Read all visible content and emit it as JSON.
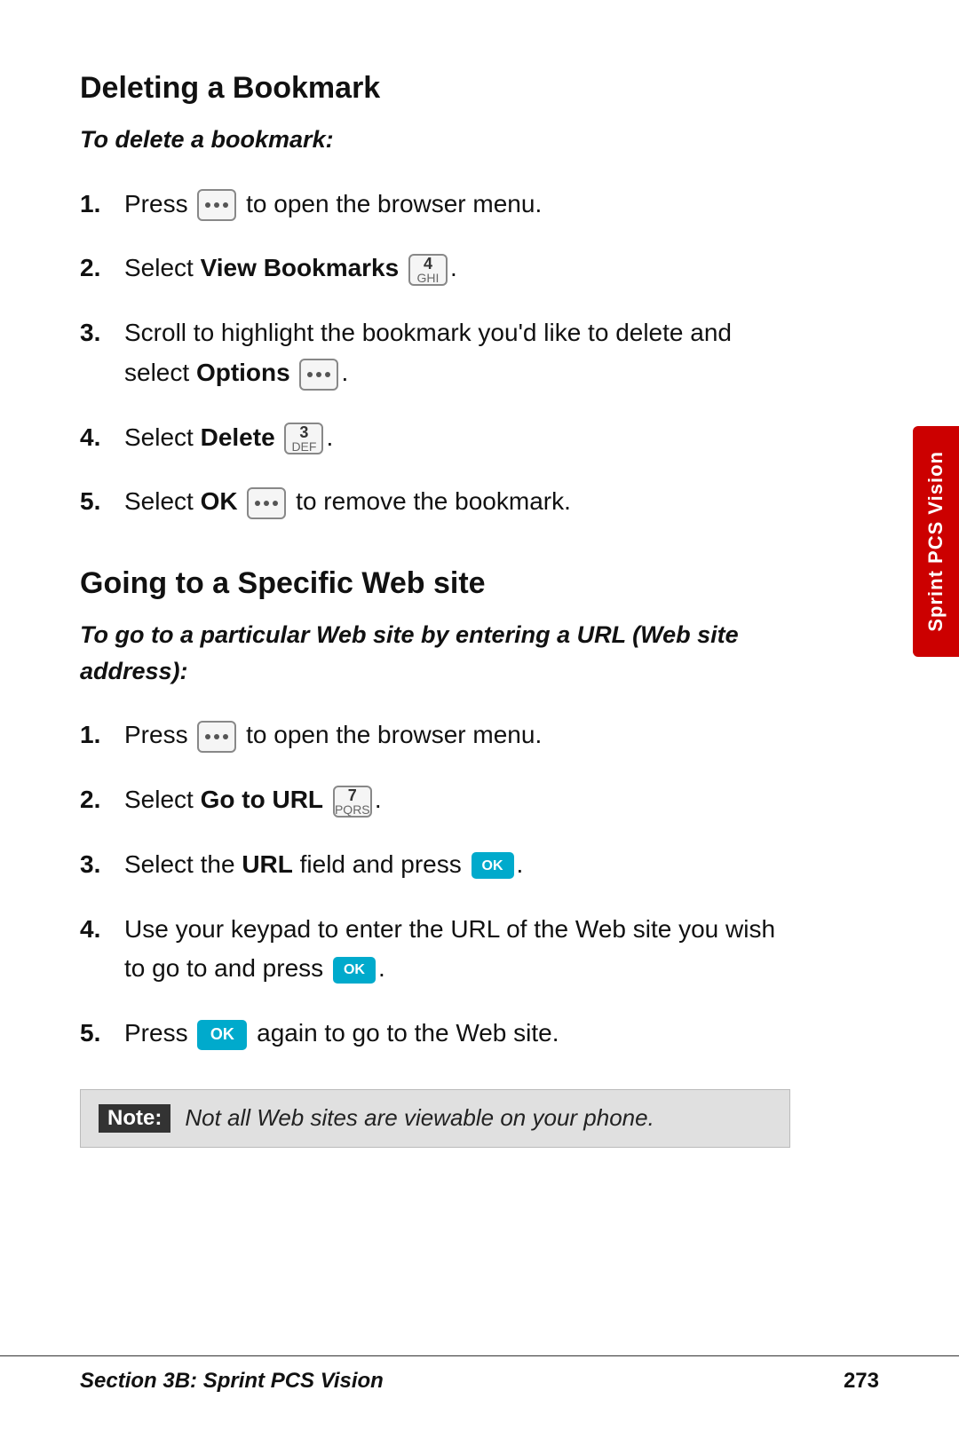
{
  "page": {
    "sections": [
      {
        "id": "deleting-bookmark",
        "heading": "Deleting a Bookmark",
        "intro": "To delete a bookmark:",
        "steps": [
          {
            "number": "1.",
            "text_before": "Press",
            "icon": "menu",
            "text_after": "to open the browser menu."
          },
          {
            "number": "2.",
            "text_before": "Select",
            "bold": "View Bookmarks",
            "icon": "key4",
            "text_after": ""
          },
          {
            "number": "3.",
            "text_before": "Scroll to highlight the bookmark you’d like to delete and select",
            "bold": "Options",
            "icon": "menu",
            "text_after": ""
          },
          {
            "number": "4.",
            "text_before": "Select",
            "bold": "Delete",
            "icon": "key3",
            "text_after": ""
          },
          {
            "number": "5.",
            "text_before": "Select",
            "bold": "OK",
            "icon": "menu",
            "text_after": "to remove the bookmark."
          }
        ]
      },
      {
        "id": "going-to-web-site",
        "heading": "Going to a Specific Web site",
        "intro": "To go to a particular Web site by entering a URL (Web site address):",
        "steps": [
          {
            "number": "1.",
            "text_before": "Press",
            "icon": "menu",
            "text_after": "to open the browser menu."
          },
          {
            "number": "2.",
            "text_before": "Select",
            "bold": "Go to URL",
            "icon": "key7",
            "text_after": ""
          },
          {
            "number": "3.",
            "text_before": "Select the",
            "bold": "URL",
            "text_mid": "field and press",
            "icon": "ok",
            "text_after": ""
          },
          {
            "number": "4.",
            "text_before": "Use your keypad to enter the URL of the Web site you wish to go to and press",
            "icon": "ok",
            "text_after": ""
          },
          {
            "number": "5.",
            "text_before": "Press",
            "icon": "ok",
            "text_after": "again to go to the Web site."
          }
        ]
      }
    ],
    "note": {
      "label": "Note:",
      "text": "Not all Web sites are viewable on your phone."
    },
    "sidebar": {
      "text": "Sprint PCS Vision"
    },
    "footer": {
      "section": "Section 3B: Sprint PCS Vision",
      "page": "273"
    }
  }
}
